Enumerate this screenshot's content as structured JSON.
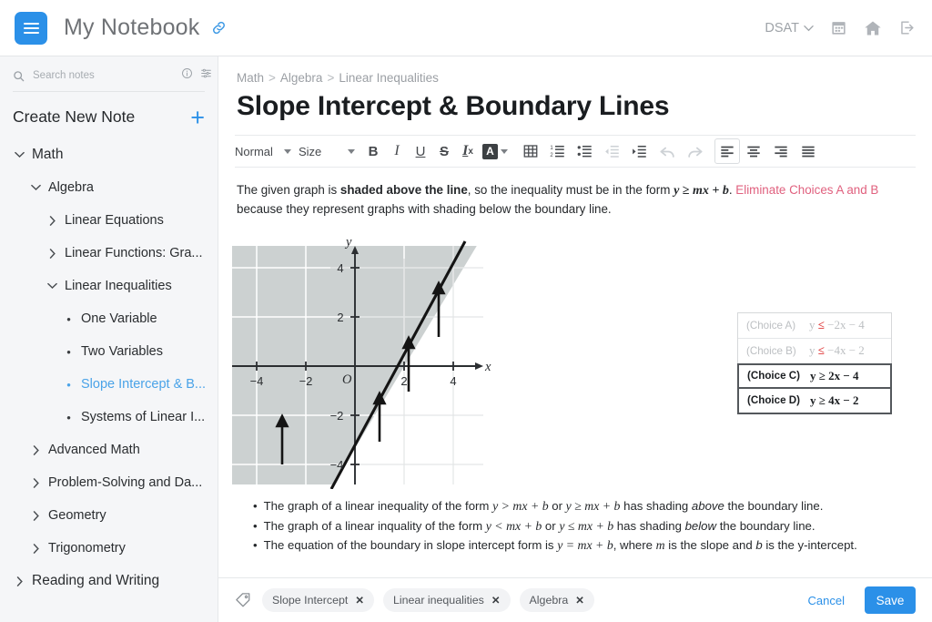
{
  "header": {
    "menu_icon": "hamburger-icon",
    "title": "My Notebook",
    "link_icon": "link-icon",
    "account_label": "DSAT",
    "chevron_icon": "chevron-down-icon",
    "calendar_icon": "calendar-icon",
    "home_icon": "home-icon",
    "logout_icon": "logout-icon",
    "accent_color": "#2b90e8"
  },
  "sidebar": {
    "search": {
      "placeholder": "Search notes",
      "value": "",
      "icon": "search-icon",
      "info_icon": "info-icon",
      "filter_icon": "filter-icon"
    },
    "create": {
      "label": "Create New Note",
      "plus": "+"
    },
    "tree": [
      {
        "label": "Math",
        "level": 0,
        "marker": "chevron-down",
        "active": false
      },
      {
        "label": "Algebra",
        "level": 1,
        "marker": "chevron-down",
        "active": false
      },
      {
        "label": "Linear Equations",
        "level": 2,
        "marker": "chevron-right",
        "active": false
      },
      {
        "label": "Linear Functions: Gra...",
        "level": 2,
        "marker": "chevron-right",
        "active": false
      },
      {
        "label": "Linear Inequalities",
        "level": 2,
        "marker": "chevron-down",
        "active": false
      },
      {
        "label": "One Variable",
        "level": 3,
        "marker": "bullet",
        "active": false
      },
      {
        "label": "Two Variables",
        "level": 3,
        "marker": "bullet",
        "active": false
      },
      {
        "label": "Slope Intercept & B...",
        "level": 3,
        "marker": "bullet",
        "active": true
      },
      {
        "label": "Systems of Linear I...",
        "level": 3,
        "marker": "bullet",
        "active": false
      },
      {
        "label": "Advanced Math",
        "level": 1,
        "marker": "chevron-right",
        "active": false
      },
      {
        "label": "Problem-Solving and Da...",
        "level": 1,
        "marker": "chevron-right",
        "active": false
      },
      {
        "label": "Geometry",
        "level": 1,
        "marker": "chevron-right",
        "active": false
      },
      {
        "label": "Trigonometry",
        "level": 1,
        "marker": "chevron-right",
        "active": false
      },
      {
        "label": "Reading and Writing",
        "level": 0,
        "marker": "chevron-right",
        "active": false
      }
    ],
    "active_color": "#4aa3e8"
  },
  "main": {
    "breadcrumb": [
      "Math",
      "Algebra",
      "Linear Inequalities"
    ],
    "breadcrumb_separator": ">",
    "title": "Slope Intercept & Boundary Lines",
    "toolbar": {
      "style_label": "Normal",
      "size_label": "Size",
      "bold": "B",
      "italic": "I",
      "underline": "U",
      "strike": "S",
      "clear_format": "Tx",
      "text_color_letter": "A",
      "icons": [
        "table-icon",
        "numbered-list-icon",
        "bullet-list-icon",
        "outdent-icon",
        "indent-icon",
        "undo-icon",
        "redo-icon",
        "align-left-icon",
        "align-center-icon",
        "align-right-icon",
        "align-justify-icon"
      ],
      "active_align": "align-left-icon",
      "disabled": [
        "outdent-icon",
        "undo-icon",
        "redo-icon"
      ]
    },
    "paragraph": {
      "p1": "The given graph is ",
      "b1": "shaded above the line",
      "p2": ", so the inequality must be in the form ",
      "i1": "y ≥ mx + b",
      "p3": ". ",
      "hl1": "Eliminate Choices A and B",
      "p4": " because they represent graphs with shading below the boundary line.",
      "highlight_color": "#e0607e"
    },
    "choices": [
      {
        "name": "(Choice A)",
        "lhs": "y ",
        "rel": "≤",
        "rhs": " −2x − 4",
        "state": "eliminated"
      },
      {
        "name": "(Choice B)",
        "lhs": "y ",
        "rel": "≤",
        "rhs": " −4x − 2",
        "state": "eliminated"
      },
      {
        "name": "(Choice C)",
        "lhs": "y ",
        "rel": "≥",
        "rhs": " 2x − 4",
        "state": "candidate"
      },
      {
        "name": "(Choice D)",
        "lhs": "y ",
        "rel": "≥",
        "rhs": " 4x − 2",
        "state": "candidate"
      }
    ],
    "bullets": [
      {
        "t1": "The graph of a linear inequality of the form ",
        "e1": "y > mx + b",
        "t2": " or ",
        "e2": "y ≥ mx + b",
        "t3": " has shading ",
        "w": "above",
        "t4": " the boundary line."
      },
      {
        "t1": "The graph of a linear inquality of the form ",
        "e1": "y < mx + b",
        "t2": " or ",
        "e2": "y ≤ mx + b",
        "t3": " has shading ",
        "w": "below",
        "t4": " the boundary line."
      },
      {
        "t1": "The equation of the boundary in slope intercept form is ",
        "e1": "y = mx + b",
        "t2": ", where ",
        "e2": "m",
        "t3": " is the slope and ",
        "w": "b",
        "t4": " is the y-intercept."
      }
    ]
  },
  "chart_data": {
    "type": "line",
    "title": "",
    "xlabel": "x",
    "ylabel": "y",
    "origin_label": "O",
    "xlim": [
      -5.2,
      5.0
    ],
    "ylim": [
      -5.0,
      5.0
    ],
    "xticks": [
      -4,
      -2,
      2,
      4
    ],
    "yticks": [
      -4,
      -2,
      2,
      4
    ],
    "grid": true,
    "grid_color": "#ffffff",
    "shading_color": "#ccd1d1",
    "boundary": {
      "equation": "y = 2x - 4",
      "slope": 2,
      "intercept": -4,
      "style": "solid",
      "color": "#1a1a1a"
    },
    "inequality": "y ≥ 2x − 4",
    "shaded_region": "above",
    "arrow_count": 4,
    "arrow_direction": "up",
    "arrow_x_positions": [
      -3,
      1,
      2.2,
      3.4
    ]
  },
  "footer": {
    "tag_icon": "tag-icon",
    "tags": [
      "Slope Intercept",
      "Linear inequalities",
      "Algebra"
    ],
    "remove_symbol": "✕",
    "cancel_label": "Cancel",
    "save_label": "Save"
  }
}
